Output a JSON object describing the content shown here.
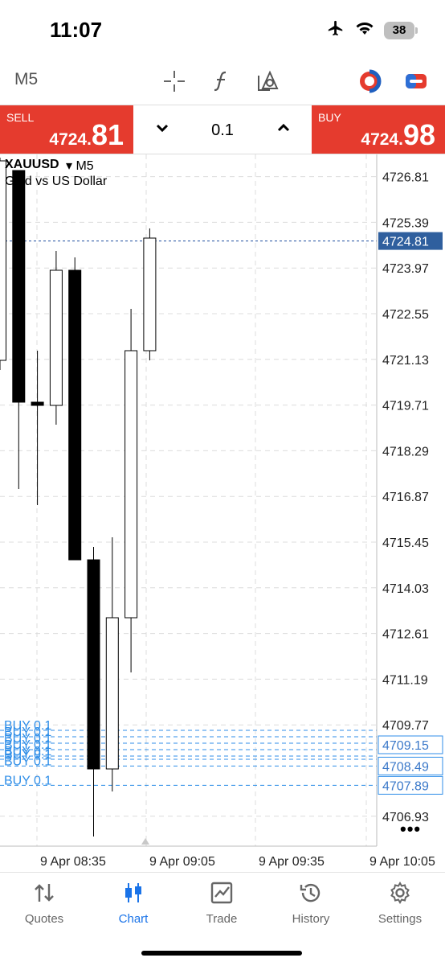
{
  "status": {
    "time": "11:07",
    "battery": "38"
  },
  "toolbar": {
    "timeframe": "M5",
    "tools": [
      "crosshair-icon",
      "function-icon",
      "objects-icon",
      "oneclick-icon",
      "toggle-icon"
    ]
  },
  "trade": {
    "sell_label": "SELL",
    "sell_small": "4724.",
    "sell_big": "81",
    "volume": "0.1",
    "buy_label": "BUY",
    "buy_small": "4724.",
    "buy_big": "98",
    "colors": {
      "sell": "#e53b2e",
      "buy": "#e53b2e"
    }
  },
  "chart": {
    "symbol": "XAUUSD",
    "timeframe_marker": "▾ M5",
    "description": "Gold vs US Dollar",
    "current_price": "4724.81",
    "price_labels": [
      "4726.81",
      "4725.39",
      "4723.97",
      "4722.55",
      "4721.13",
      "4719.71",
      "4718.29",
      "4716.87",
      "4715.45",
      "4714.03",
      "4712.61",
      "4711.19",
      "4709.77",
      "4706.93"
    ],
    "order_price_tags": [
      "4709.15",
      "4708.49",
      "4707.89"
    ],
    "order_lines_label": "BUY 0.1",
    "time_labels": [
      "9 Apr 08:35",
      "9 Apr 09:05",
      "9 Apr 09:35",
      "9 Apr 10:05"
    ],
    "more": "•••"
  },
  "chart_data": {
    "type": "candlestick",
    "title": "XAUUSD",
    "subtitle": "Gold vs US Dollar",
    "ylim": [
      4706.0,
      4727.5
    ],
    "x_ticks": [
      "9 Apr 08:35",
      "9 Apr 09:05",
      "9 Apr 09:35",
      "9 Apr 10:05"
    ],
    "candles": [
      {
        "open": 4721.1,
        "high": 4727.4,
        "low": 4720.8,
        "close": 4727.3
      },
      {
        "open": 4727.0,
        "high": 4727.0,
        "low": 4717.1,
        "close": 4719.8
      },
      {
        "open": 4719.8,
        "high": 4721.4,
        "low": 4716.6,
        "close": 4719.7
      },
      {
        "open": 4719.7,
        "high": 4724.5,
        "low": 4719.1,
        "close": 4723.9
      },
      {
        "open": 4723.9,
        "high": 4724.3,
        "low": 4714.9,
        "close": 4714.9
      },
      {
        "open": 4714.9,
        "high": 4715.3,
        "low": 4706.3,
        "close": 4708.4
      },
      {
        "open": 4708.4,
        "high": 4715.6,
        "low": 4707.7,
        "close": 4713.1
      },
      {
        "open": 4713.1,
        "high": 4722.7,
        "low": 4711.4,
        "close": 4721.4
      },
      {
        "open": 4721.4,
        "high": 4725.2,
        "low": 4721.1,
        "close": 4724.9
      }
    ],
    "current_price": 4724.81,
    "buy_orders": [
      {
        "price": 4709.6,
        "volume": 0.1
      },
      {
        "price": 4709.4,
        "volume": 0.1
      },
      {
        "price": 4709.2,
        "volume": 0.1
      },
      {
        "price": 4709.0,
        "volume": 0.1
      },
      {
        "price": 4708.8,
        "volume": 0.1
      },
      {
        "price": 4708.7,
        "volume": 0.1
      },
      {
        "price": 4708.49,
        "volume": 0.1
      },
      {
        "price": 4707.89,
        "volume": 0.1
      }
    ],
    "colors": {
      "bull": "#ffffff",
      "bear": "#000000",
      "price_line": "#1f4e9e",
      "order": "#2f8ee8",
      "tag": "#3a78c9"
    }
  },
  "tabs": [
    {
      "label": "Quotes",
      "icon": "quotes-icon",
      "active": false
    },
    {
      "label": "Chart",
      "icon": "chart-icon",
      "active": true
    },
    {
      "label": "Trade",
      "icon": "trade-icon",
      "active": false
    },
    {
      "label": "History",
      "icon": "history-icon",
      "active": false
    },
    {
      "label": "Settings",
      "icon": "settings-icon",
      "active": false
    }
  ]
}
